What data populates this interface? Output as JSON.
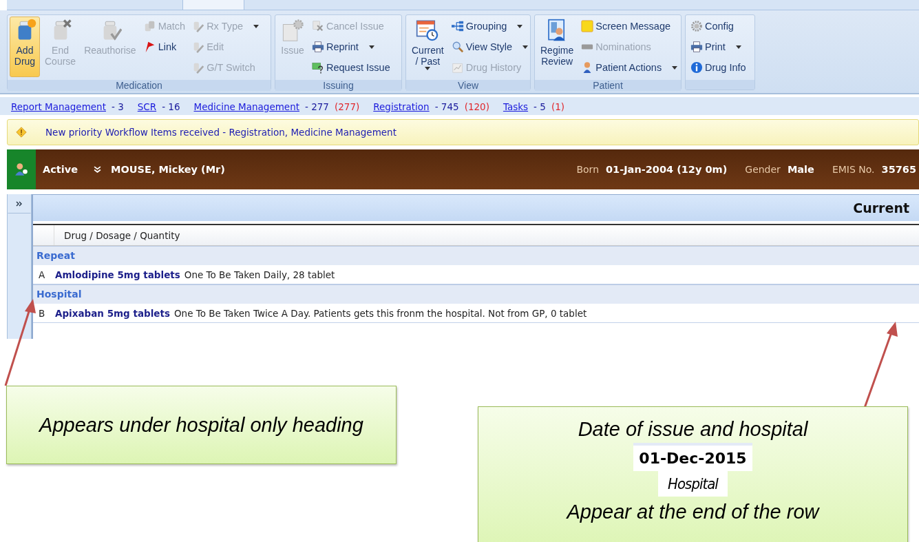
{
  "ribbon": {
    "groups": [
      {
        "label": "Medication",
        "columns": [
          [
            {
              "label": "Add\nDrug",
              "kind": "large",
              "disabled": false,
              "highlighted": true
            }
          ],
          [
            {
              "label": "End\nCourse",
              "kind": "large",
              "disabled": true,
              "highlighted": false
            }
          ],
          [
            {
              "label": "Reauthorise",
              "kind": "large",
              "disabled": true,
              "highlighted": false
            }
          ],
          [
            {
              "label": "Match",
              "kind": "small",
              "disabled": true,
              "dropdown": false
            },
            {
              "label": "Link",
              "kind": "small",
              "disabled": false,
              "dropdown": false
            }
          ],
          [
            {
              "label": "Rx Type",
              "kind": "small",
              "disabled": true,
              "dropdown": true
            },
            {
              "label": "Edit",
              "kind": "small",
              "disabled": true,
              "dropdown": false
            },
            {
              "label": "G/T Switch",
              "kind": "small",
              "disabled": true,
              "dropdown": false
            }
          ]
        ]
      },
      {
        "label": "Issuing",
        "columns": [
          [
            {
              "label": "Issue",
              "kind": "large",
              "disabled": true,
              "highlighted": false
            }
          ],
          [
            {
              "label": "Cancel Issue",
              "kind": "small",
              "disabled": true,
              "dropdown": false
            },
            {
              "label": "Reprint",
              "kind": "small",
              "disabled": false,
              "dropdown": true
            },
            {
              "label": "Request Issue",
              "kind": "small",
              "disabled": false,
              "dropdown": false
            }
          ]
        ]
      },
      {
        "label": "View",
        "columns": [
          [
            {
              "label": "Current\n/ Past",
              "kind": "large",
              "disabled": false,
              "highlighted": false,
              "dropdown": true
            }
          ],
          [
            {
              "label": "Grouping",
              "kind": "small",
              "disabled": false,
              "dropdown": true
            },
            {
              "label": "View Style",
              "kind": "small",
              "disabled": false,
              "dropdown": true
            },
            {
              "label": "Drug History",
              "kind": "small",
              "disabled": true,
              "dropdown": false
            }
          ]
        ]
      },
      {
        "label": "Patient",
        "columns": [
          [
            {
              "label": "Regime\nReview",
              "kind": "large",
              "disabled": false,
              "highlighted": false
            }
          ],
          [
            {
              "label": "Screen Message",
              "kind": "small",
              "disabled": false,
              "dropdown": false
            },
            {
              "label": "Nominations",
              "kind": "small",
              "disabled": true,
              "dropdown": false
            },
            {
              "label": "Patient Actions",
              "kind": "small",
              "disabled": false,
              "dropdown": true
            }
          ]
        ]
      },
      {
        "columns": [
          [
            {
              "label": "Config",
              "kind": "small",
              "disabled": false,
              "dropdown": false
            },
            {
              "label": "Print",
              "kind": "small",
              "disabled": false,
              "dropdown": true
            },
            {
              "label": "Drug Info",
              "kind": "small",
              "disabled": false,
              "dropdown": false
            }
          ]
        ]
      }
    ]
  },
  "workflow_links": [
    {
      "link": "Report Management",
      "count": "- 3"
    },
    {
      "link": "SCR",
      "count": "- 16"
    },
    {
      "link": "Medicine Management",
      "count": "- 277",
      "priority": "(277)"
    },
    {
      "link": "Registration",
      "count": "- 745",
      "priority": "(120)"
    },
    {
      "link": "Tasks",
      "count": "- 5",
      "priority": "(1)"
    }
  ],
  "notice": "New priority Workflow Items received - Registration, Medicine Management",
  "patient_banner": {
    "status": "Active",
    "name": "MOUSE, Mickey (Mr)",
    "fields": [
      {
        "label": "Born",
        "value": "01-Jan-2004 (12y 0m)"
      },
      {
        "label": "Gender",
        "value": "Male"
      },
      {
        "label": "EMIS No.",
        "value": "35765"
      }
    ]
  },
  "medication_panel": {
    "title": "Current",
    "column": "Drug / Dosage / Quantity",
    "groups": [
      {
        "heading": "Repeat",
        "rows": [
          {
            "code": "A",
            "drug": "Amlodipine 5mg tablets",
            "dosage": "One To Be Taken Daily, 28 tablet"
          }
        ]
      },
      {
        "heading": "Hospital",
        "rows": [
          {
            "code": "B",
            "drug": "Apixaban 5mg tablets",
            "dosage": "One To Be Taken Twice A Day. Patients gets this fronm the hospital. Not from GP, 0 tablet"
          }
        ]
      }
    ]
  },
  "callouts": [
    {
      "kind": "note",
      "text": "Appears under hospital only heading"
    },
    {
      "kind": "example",
      "title": "Date of issue and hospital",
      "date": "01-Dec-2015",
      "source": "Hospital",
      "footer": "Appear at the end of the row"
    }
  ]
}
